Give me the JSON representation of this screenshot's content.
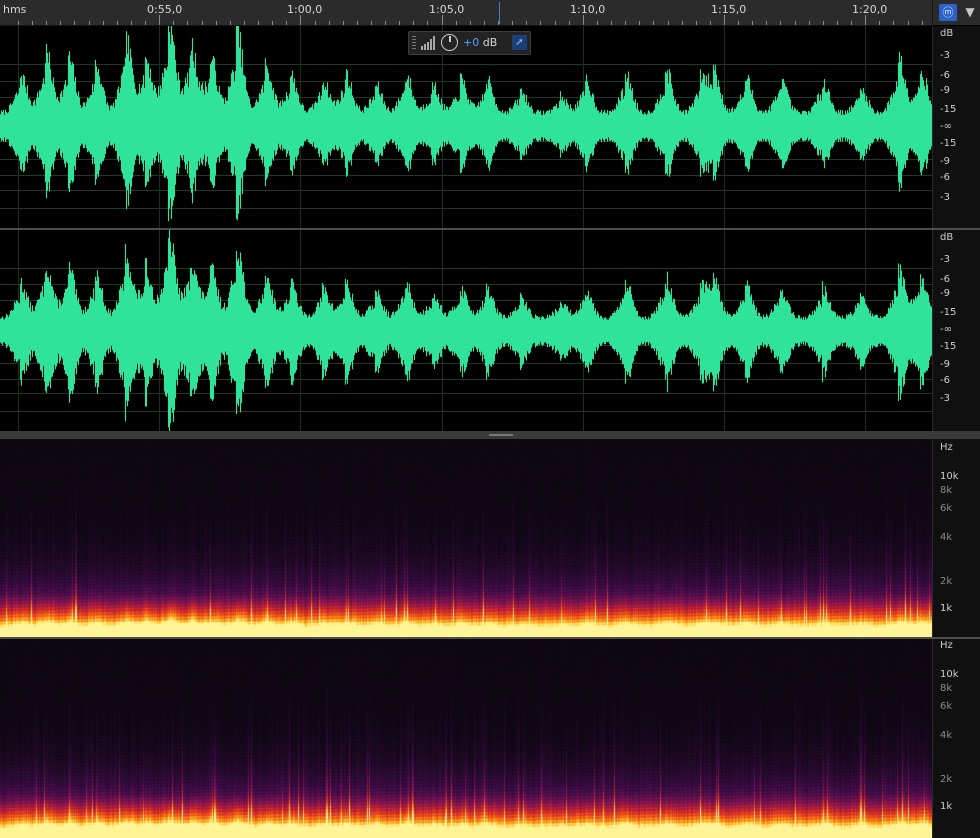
{
  "ruler": {
    "unit_label": "hms",
    "time_labels": [
      "0:55,0",
      "1:00,0",
      "1:05,0",
      "1:10,0",
      "1:15,0",
      "1:20,0"
    ]
  },
  "corner": {
    "headphones_icon": "headphones-icon",
    "pin_icon": "marker-pin-icon"
  },
  "hud": {
    "gain_value": "+0",
    "gain_unit": " dB",
    "meter_icon": "level-meter-icon",
    "dial_icon": "volume-knob-icon",
    "pin_icon": "pin-hud-icon"
  },
  "waveform": {
    "color": "#2fe39b",
    "db_scale": {
      "unit": "dB",
      "labels": [
        "-3",
        "-6",
        "-9",
        "-15",
        "-∞",
        "-15",
        "-9",
        "-6",
        "-3"
      ]
    }
  },
  "spectral": {
    "hz_scale": {
      "unit": "Hz",
      "labels": [
        "10k",
        "8k",
        "6k",
        "4k",
        "2k",
        "1k"
      ]
    }
  }
}
